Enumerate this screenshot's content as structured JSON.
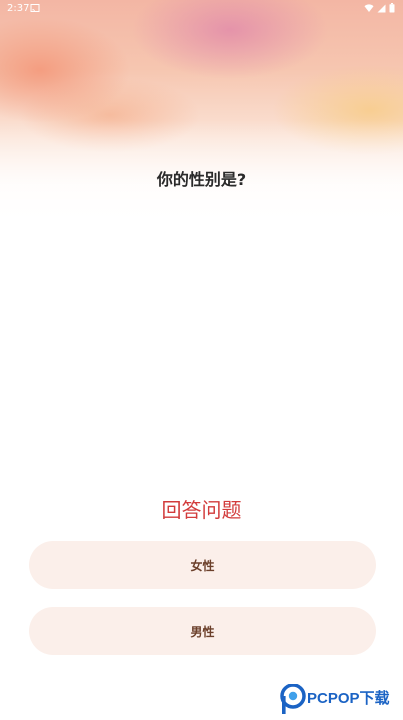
{
  "status_bar": {
    "time": "2:37",
    "icons": [
      "cast-icon",
      "wifi-icon",
      "signal-icon",
      "battery-icon"
    ]
  },
  "quiz": {
    "question": "你的性别是?",
    "section_title": "回答问题",
    "options": [
      {
        "label": "女性"
      },
      {
        "label": "男性"
      }
    ]
  },
  "watermark": {
    "brand": "PCPOP",
    "suffix": "下载"
  },
  "colors": {
    "section_title": "#d23b3b",
    "option_bg": "#fbefea",
    "option_text": "#6b3f2a",
    "question_text": "#2a2a2a",
    "watermark_blue": "#1b63c4"
  }
}
